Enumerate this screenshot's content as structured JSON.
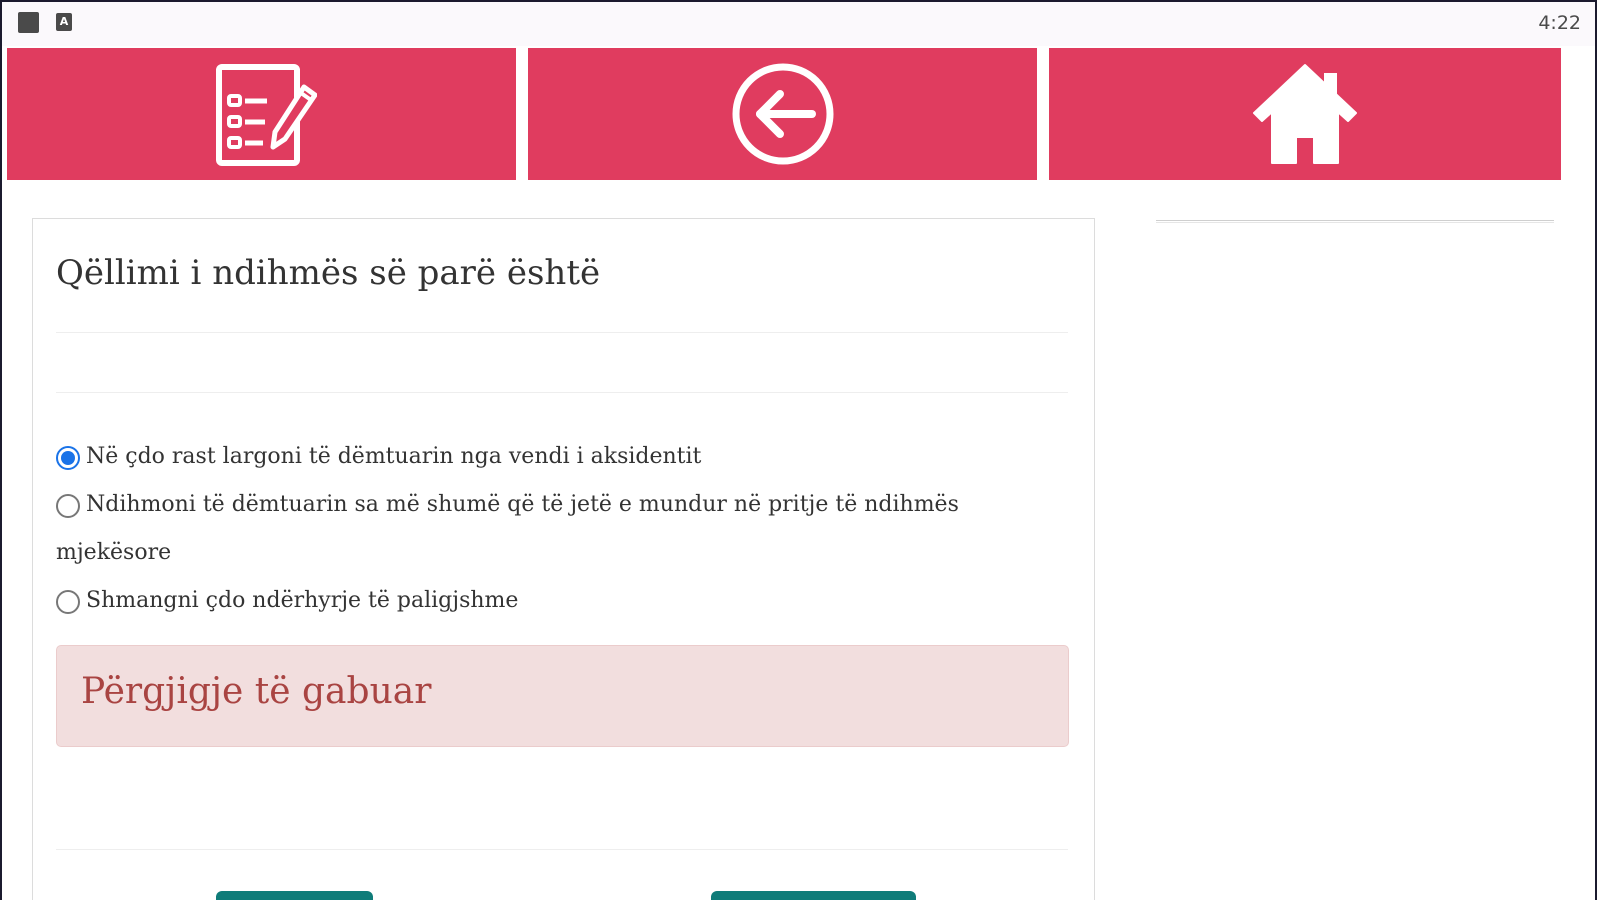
{
  "status_bar": {
    "left_icons": [
      "square-icon",
      "a-letter-icon"
    ],
    "a_letter": "A",
    "time": "4:22"
  },
  "toolbar": {
    "color": "#e03c5f",
    "buttons": [
      {
        "name": "quiz-list-button",
        "icon": "checklist-pencil-icon"
      },
      {
        "name": "back-button",
        "icon": "arrow-left-circle-icon"
      },
      {
        "name": "home-button",
        "icon": "home-icon"
      }
    ]
  },
  "question": {
    "title": "Qëllimi i ndihmës së parë është",
    "answers": [
      {
        "text": "Në çdo rast largoni të dëmtuarin nga vendi i aksidentit",
        "selected": true
      },
      {
        "text_line1": "Ndihmoni të dëmtuarin sa më shumë që të jetë e mundur në pritje të ndihmës",
        "text_line2": "mjekësore",
        "selected": false
      },
      {
        "text": "Shmangni çdo ndërhyrje të paligjshme",
        "selected": false
      }
    ],
    "feedback": "Përgjigje të gabuar"
  },
  "colors": {
    "accent": "#e03c5f",
    "radio_selected": "#1a73e8",
    "alert_bg": "#f2dede",
    "alert_text": "#a94442",
    "bottom_button": "#0f7c79"
  }
}
